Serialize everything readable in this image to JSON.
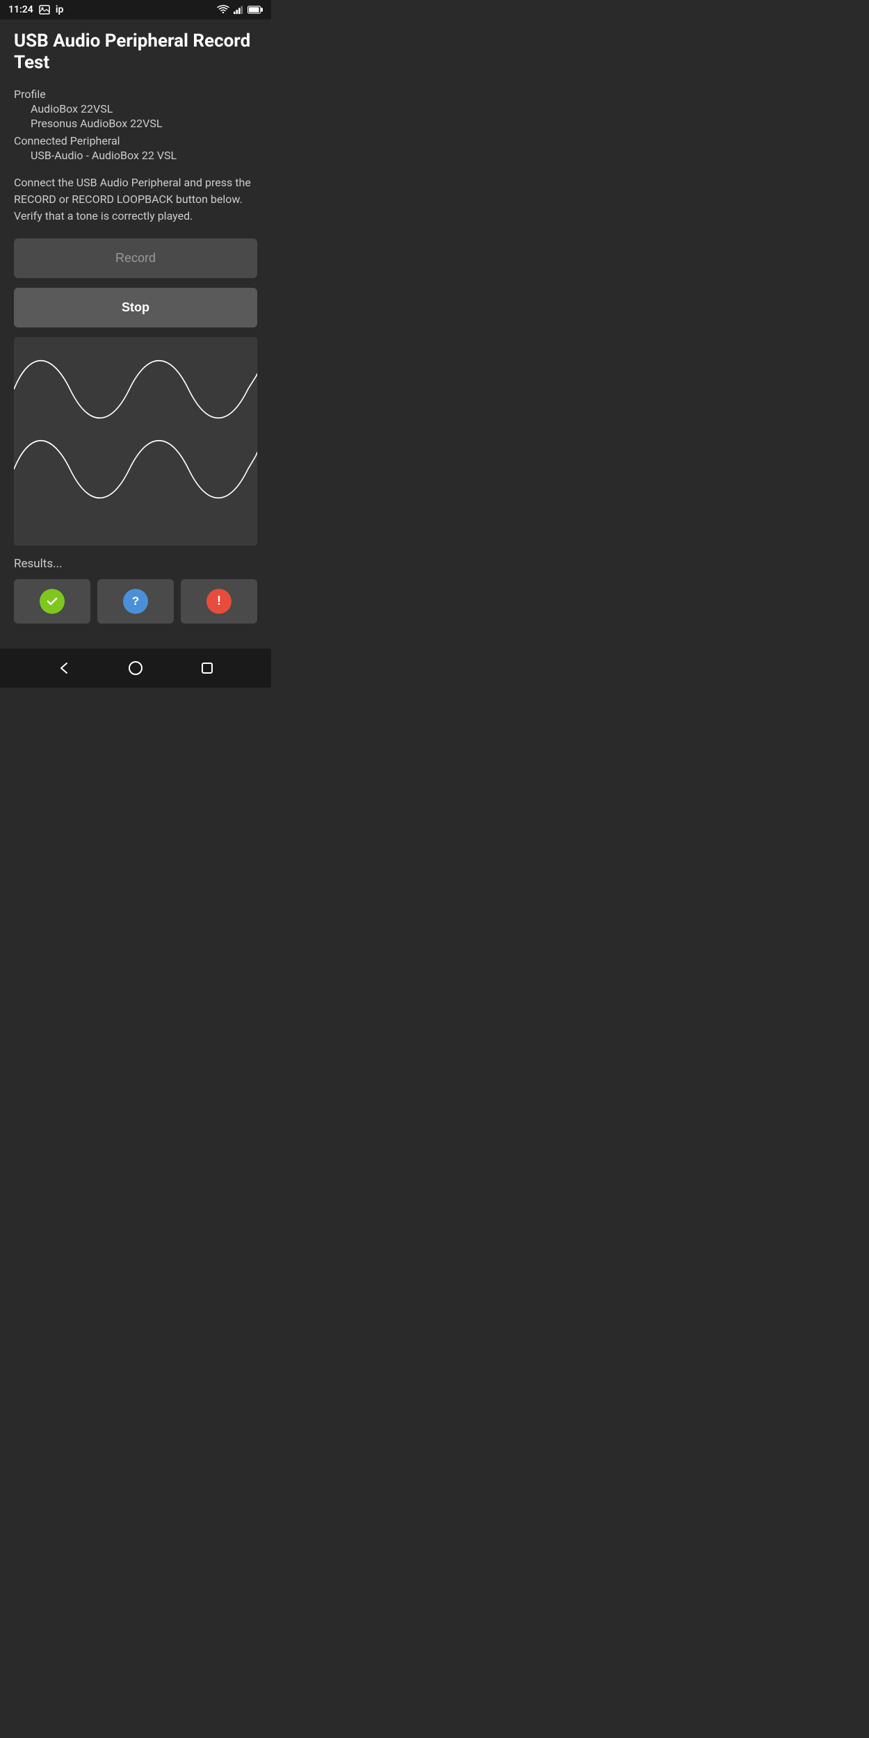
{
  "status_bar": {
    "time": "11:24",
    "icons": [
      "image",
      "ip"
    ]
  },
  "header": {
    "title": "USB Audio Peripheral Record Test"
  },
  "profile": {
    "label": "Profile",
    "device_name": "AudioBox 22VSL",
    "device_full": "Presonus AudioBox 22VSL",
    "peripheral_label": "Connected Peripheral",
    "peripheral_value": "USB-Audio - AudioBox 22 VSL"
  },
  "description": "Connect the USB Audio Peripheral and press the RECORD or RECORD LOOPBACK button below. Verify that a tone is correctly played.",
  "buttons": {
    "record_label": "Record",
    "stop_label": "Stop"
  },
  "results": {
    "label": "Results...",
    "buttons": [
      {
        "type": "check",
        "aria": "Pass"
      },
      {
        "type": "question",
        "aria": "Unknown"
      },
      {
        "type": "exclaim",
        "aria": "Fail"
      }
    ]
  },
  "nav": {
    "back": "Back",
    "home": "Home",
    "recents": "Recents"
  },
  "colors": {
    "background": "#2a2a2a",
    "status_bar": "#1a1a1a",
    "button_record_bg": "#4a4a4a",
    "button_stop_bg": "#5a5a5a",
    "waveform_bg": "#3a3a3a",
    "result_btn_bg": "#4a4a4a",
    "check_color": "#7dc71e",
    "question_color": "#4a90d9",
    "exclaim_color": "#e74c3c"
  }
}
